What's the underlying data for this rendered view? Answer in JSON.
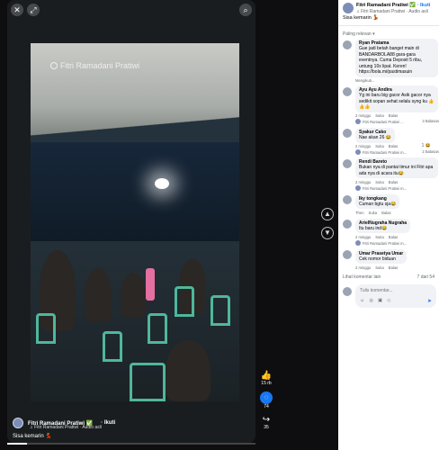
{
  "video": {
    "watermark": "Fitri Ramadani Pratiwi",
    "author_name": "Fitri Ramadani Pratiwi ✅",
    "follow_label": "· Ikuti",
    "audio": "♫ Fitri Ramadani Pratiwi · Audio asli",
    "caption": "Sisa kemarin 💃",
    "progress_percent": 8,
    "icons": {
      "close": "close-icon",
      "expand": "expand-icon",
      "search": "search-icon"
    }
  },
  "actions": {
    "likes": "15 rb",
    "comments": "74",
    "shares": "35"
  },
  "nav": {
    "up": "▲",
    "down": "▼"
  },
  "panel": {
    "author_name": "Fitri Ramadani Pratiwi ✅",
    "follow_label": " · Ikuti",
    "audio": "♫ Fitri Ramadani Pratiwi · Audio asli",
    "caption": "Sisa kemarin 💃",
    "sort_label": "Paling relevan ▾",
    "more_comments": "Lihat komentar lain",
    "count_label": "7 dari 54",
    "composer_placeholder": "Tulis komentar...",
    "composer_icons": "☺ ◎ ▣ ◇",
    "send_icon": "➤"
  },
  "comments": [
    {
      "name": "Ryan Pratama",
      "text": "Gue jadi betah banget main di BANDARBOLA88 gara-gara eventnya. Cuma Deposit 5 ribu, untung 10x lipat. Keren! https://bola.mi/pastimasuin",
      "time": "Mengikuti...",
      "like": "",
      "reply": "",
      "reactions": "",
      "reply_row": "",
      "reply_count": ""
    },
    {
      "name": "Ayu Ayu Andira",
      "text": "Yg ini baru big gacor Asik gacor nya sedikit sopan sehat selalu syng ku 👍👍👍",
      "time": "2 minggu",
      "like": "Suka",
      "reply": "Balas",
      "reactions": "",
      "reply_row": "Fitri Ramadani Pratiwi ...",
      "reply_count": "3 Balasan"
    },
    {
      "name": "Syakur Cako",
      "text": "Nae akan 26 😂",
      "time": "2 minggu",
      "like": "Suka",
      "reply": "Balas",
      "reactions": "1 😆",
      "reply_row": "Fitri Ramadani Pratiwi m...",
      "reply_count": "2 Balasan"
    },
    {
      "name": "Rendi Bareto",
      "text": "Bukan nya di pantai timur ini Fitri apa ada nya di acara itu😂",
      "time": "2 minggu",
      "like": "Suka",
      "reply": "Balas",
      "reactions": "",
      "reply_row": "Fitri Ramadani Pratiwi m...",
      "reply_count": ""
    },
    {
      "name": "Iky tongkang",
      "text": "Cuman bgtu sja😂",
      "time": "Then",
      "like": "Suka",
      "reply": "Balas",
      "reactions": "",
      "reply_row": "",
      "reply_count": ""
    },
    {
      "name": "ArielNugraha Nugraha",
      "text": "Itu baru ind😂",
      "time": "2 minggu",
      "like": "Suka",
      "reply": "Balas",
      "reactions": "",
      "reply_row": "Fitri Ramadani Pratiwi m...",
      "reply_count": ""
    },
    {
      "name": "Umar Prasetya Umar",
      "text": "Cek nomor biduan",
      "time": "2 minggu",
      "like": "Suka",
      "reply": "Balas",
      "reactions": "",
      "reply_row": "",
      "reply_count": ""
    }
  ]
}
